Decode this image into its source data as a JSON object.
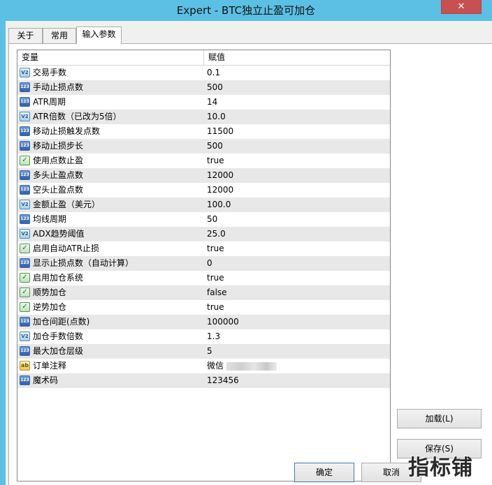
{
  "window": {
    "title": "Expert - BTC独立止盈可加仓",
    "close_glyph": "✕"
  },
  "tabs": [
    {
      "label": "关于"
    },
    {
      "label": "常用"
    },
    {
      "label": "输入参数"
    }
  ],
  "grid": {
    "headers": {
      "name": "变量",
      "value": "赋值"
    },
    "rows": [
      {
        "type": "double",
        "icon": "V2",
        "name": "交易手数",
        "value": "0.1"
      },
      {
        "type": "int",
        "icon": "123",
        "name": "手动止损点数",
        "value": "500"
      },
      {
        "type": "int",
        "icon": "123",
        "name": "ATR周期",
        "value": "14"
      },
      {
        "type": "double",
        "icon": "V2",
        "name": "ATR倍数（已改为5倍）",
        "value": "10.0"
      },
      {
        "type": "int",
        "icon": "123",
        "name": "移动止损触发点数",
        "value": "11500"
      },
      {
        "type": "int",
        "icon": "123",
        "name": "移动止损步长",
        "value": "500"
      },
      {
        "type": "bool",
        "icon": "✓",
        "name": "使用点数止盈",
        "value": "true"
      },
      {
        "type": "int",
        "icon": "123",
        "name": "多头止盈点数",
        "value": "12000"
      },
      {
        "type": "int",
        "icon": "123",
        "name": "空头止盈点数",
        "value": "12000"
      },
      {
        "type": "double",
        "icon": "V2",
        "name": "金额止盈（美元）",
        "value": "100.0"
      },
      {
        "type": "int",
        "icon": "123",
        "name": "均线周期",
        "value": "50"
      },
      {
        "type": "double",
        "icon": "V2",
        "name": "ADX趋势阈值",
        "value": "25.0"
      },
      {
        "type": "bool",
        "icon": "✓",
        "name": "启用自动ATR止损",
        "value": "true"
      },
      {
        "type": "int",
        "icon": "123",
        "name": "显示止损点数（自动计算）",
        "value": "0"
      },
      {
        "type": "bool",
        "icon": "✓",
        "name": "启用加仓系统",
        "value": "true"
      },
      {
        "type": "bool",
        "icon": "✓",
        "name": "顺势加仓",
        "value": "false"
      },
      {
        "type": "bool",
        "icon": "✓",
        "name": "逆势加仓",
        "value": "true"
      },
      {
        "type": "int",
        "icon": "123",
        "name": "加仓间距(点数)",
        "value": "100000"
      },
      {
        "type": "double",
        "icon": "V2",
        "name": "加仓手数倍数",
        "value": "1.3"
      },
      {
        "type": "int",
        "icon": "123",
        "name": "最大加仓层级",
        "value": "5"
      },
      {
        "type": "string",
        "icon": "ab",
        "name": "订单注释",
        "value": "微信"
      },
      {
        "type": "int",
        "icon": "123",
        "name": "魔术码",
        "value": "123456"
      }
    ]
  },
  "buttons": {
    "load": "加载(L)",
    "save": "保存(S)",
    "ok": "确定",
    "cancel": "取消"
  },
  "watermark": "指标铺"
}
